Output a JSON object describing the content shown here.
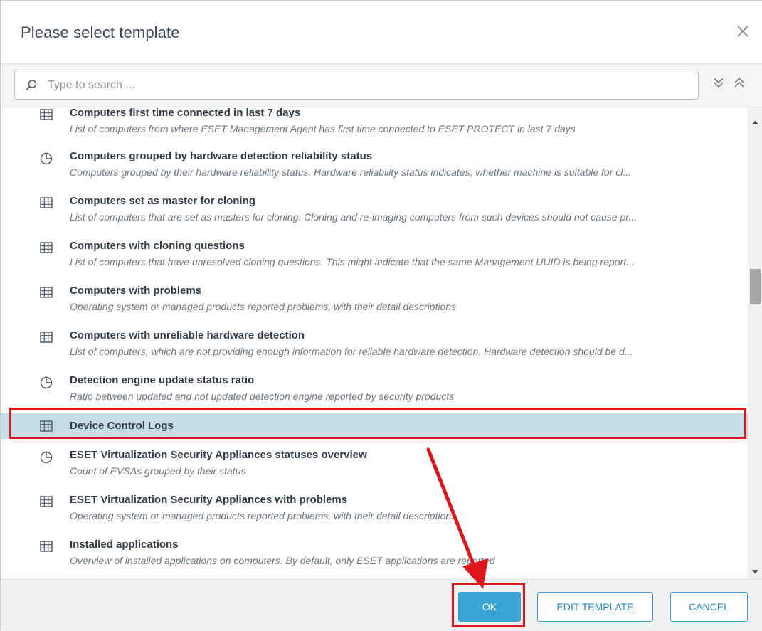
{
  "dialog": {
    "title": "Please select template",
    "close_icon": "close-icon"
  },
  "search": {
    "placeholder": "Type to search ...",
    "value": "",
    "expand_icon": "expand-all-icon",
    "collapse_icon": "collapse-all-icon"
  },
  "templates": [
    {
      "icon": "table-icon",
      "title": "Computers first time connected in last 7 days",
      "description": "List of computers from where ESET Management Agent has first time connected to ESET PROTECT in last 7 days"
    },
    {
      "icon": "pie-chart-icon",
      "title": "Computers grouped by hardware detection reliability status",
      "description": "Computers grouped by their hardware reliability status. Hardware reliability status indicates, whether machine is suitable for cl..."
    },
    {
      "icon": "table-icon",
      "title": "Computers set as master for cloning",
      "description": "List of computers that are set as masters for cloning. Cloning and re-imaging computers from such devices should not cause pr..."
    },
    {
      "icon": "table-icon",
      "title": "Computers with cloning questions",
      "description": "List of computers that have unresolved cloning questions. This might indicate that the same Management UUID is being report..."
    },
    {
      "icon": "table-icon",
      "title": "Computers with problems",
      "description": "Operating system or managed products reported problems, with their detail descriptions"
    },
    {
      "icon": "table-icon",
      "title": "Computers with unreliable hardware detection",
      "description": "List of computers, which are not providing enough information for reliable hardware detection. Hardware detection should be d..."
    },
    {
      "icon": "pie-chart-icon",
      "title": "Detection engine update status ratio",
      "description": "Ratio between updated and not updated detection engine reported by security products"
    },
    {
      "icon": "table-icon",
      "title": "Device Control Logs",
      "description": "",
      "selected": true
    },
    {
      "icon": "pie-chart-icon",
      "title": "ESET Virtualization Security Appliances statuses overview",
      "description": "Count of EVSAs grouped by their status"
    },
    {
      "icon": "table-icon",
      "title": "ESET Virtualization Security Appliances with problems",
      "description": "Operating system or managed products reported problems, with their detail descriptions"
    },
    {
      "icon": "table-icon",
      "title": "Installed applications",
      "description": "Overview of installed applications on computers. By default, only ESET applications are reported"
    }
  ],
  "buttons": {
    "ok": "OK",
    "edit_template": "EDIT TEMPLATE",
    "cancel": "CANCEL"
  },
  "colors": {
    "accent": "#3aa3d6",
    "selected_row": "#c5dde6",
    "annotation": "#e0151b"
  }
}
